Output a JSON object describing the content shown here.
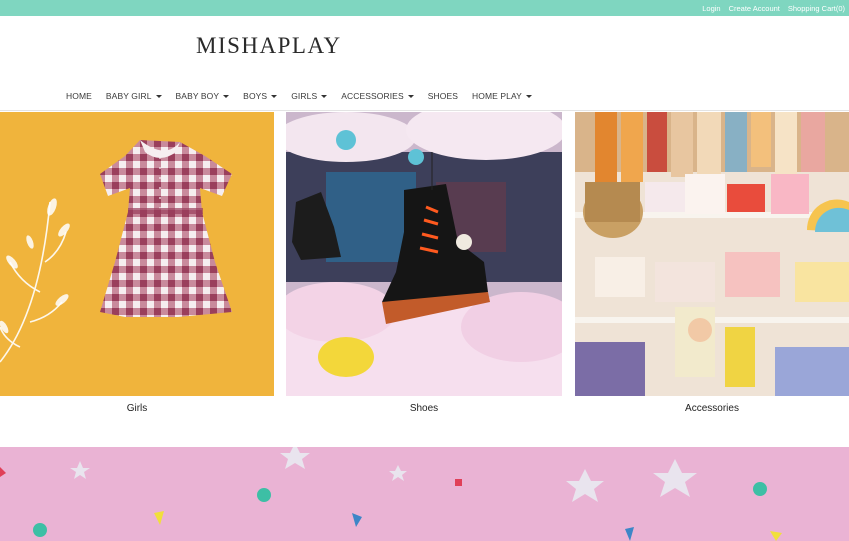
{
  "topbar": {
    "login": "Login",
    "create_account": "Create Account",
    "shopping_cart": "Shopping Cart(0)"
  },
  "brand": {
    "logo_text": "MISHAPLAY"
  },
  "nav": {
    "items": [
      {
        "label": "HOME",
        "has_dropdown": false
      },
      {
        "label": "BABY GIRL",
        "has_dropdown": true
      },
      {
        "label": "BABY BOY",
        "has_dropdown": true
      },
      {
        "label": "BOYS",
        "has_dropdown": true
      },
      {
        "label": "GIRLS",
        "has_dropdown": true
      },
      {
        "label": "ACCESSORIES",
        "has_dropdown": true
      },
      {
        "label": "SHOES",
        "has_dropdown": false
      },
      {
        "label": "HOME PLAY",
        "has_dropdown": true
      }
    ]
  },
  "categories": [
    {
      "label": "Girls",
      "image": "gingham-dress"
    },
    {
      "label": "Shoes",
      "image": "black-boot-in-clouds"
    },
    {
      "label": "Accessories",
      "image": "accessories-shop-display"
    }
  ],
  "colors": {
    "topbar": "#7fd6c0",
    "banner": "#eab3d4",
    "girls_bg": "#f0b43c"
  }
}
